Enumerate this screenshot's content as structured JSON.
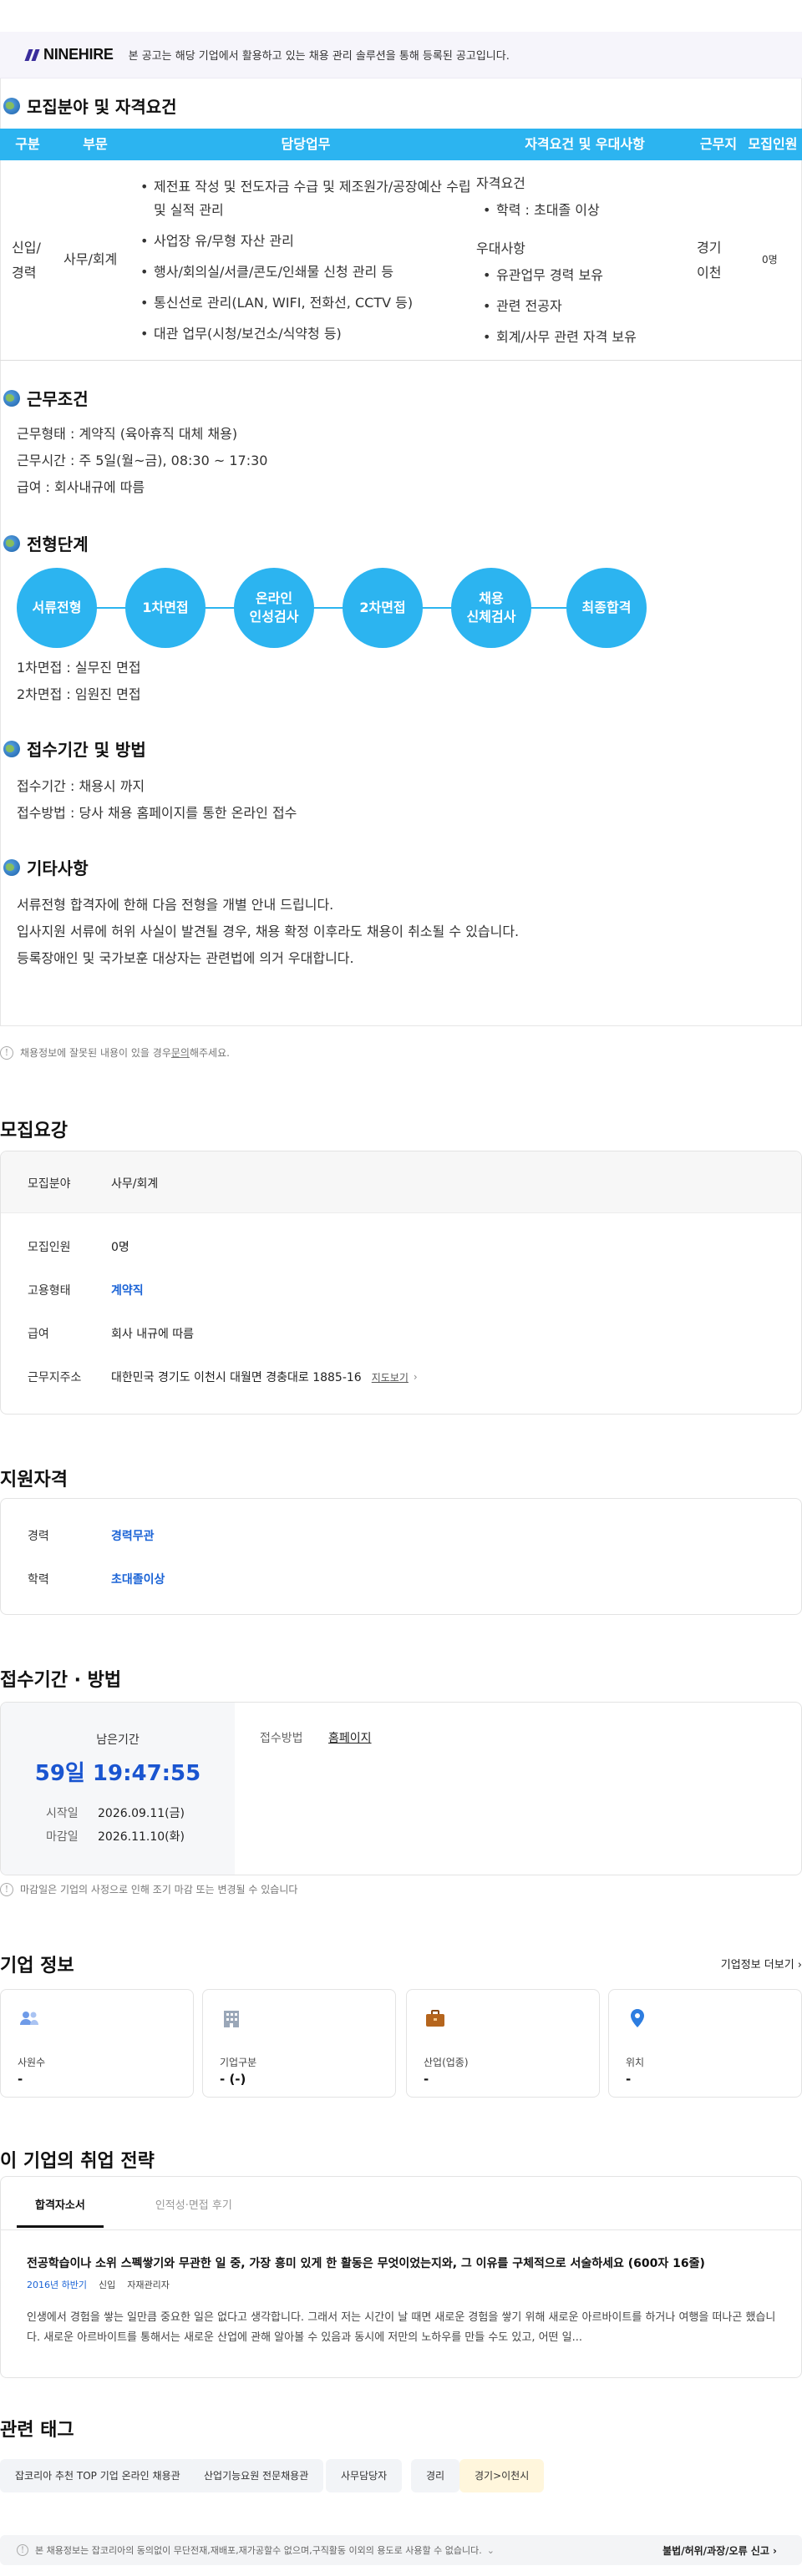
{
  "banner": {
    "logo": "NINEHIRE",
    "text": "본 공고는 해당 기업에서 활용하고 있는 채용 관리 솔루션을 통해 등록된 공고입니다."
  },
  "recruit_field": {
    "title": "모집분야 및 자격요건",
    "headers": [
      "구분",
      "부문",
      "담당업무",
      "자격요건 및 우대사항",
      "근무지",
      "모집인원"
    ],
    "category": "신입/\n경력",
    "department": "사무/회계",
    "duties": [
      "제전표 작성 및 전도자금 수급 및 제조원가/공장예산 수립 및 실적 관리",
      "사업장 유/무형 자산 관리",
      "행사/회의실/서클/콘도/인쇄물 신청 관리 등",
      "통신선로 관리(LAN, WIFI, 전화선, CCTV 등)",
      "대관 업무(시청/보건소/식약청 등)"
    ],
    "qual_label": "자격요건",
    "qual_items": [
      "학력 : 초대졸 이상"
    ],
    "pref_label": "우대사항",
    "pref_items": [
      "유관업무 경력 보유",
      "관련 전공자",
      "회계/사무 관련 자격 보유"
    ],
    "location": "경기\n이천",
    "headcount": "0명"
  },
  "work_conditions": {
    "title": "근무조건",
    "lines": [
      "근무형태 : 계약직 (육아휴직 대체 채용)",
      "근무시간 : 주 5일(월~금), 08:30 ~ 17:30",
      "급여 : 회사내규에 따름"
    ]
  },
  "process": {
    "title": "전형단계",
    "steps": [
      "서류전형",
      "1차면접",
      "온라인\n인성검사",
      "2차면접",
      "채용\n신체검사",
      "최종합격"
    ],
    "notes": [
      "1차면접 : 실무진 면접",
      "2차면접 : 임원진 면접"
    ]
  },
  "apply_period": {
    "title": "접수기간 및 방법",
    "lines": [
      "접수기간 : 채용시 까지",
      "접수방법 : 당사 채용 홈페이지를 통한 온라인 접수"
    ]
  },
  "etc": {
    "title": "기타사항",
    "lines": [
      "서류전형 합격자에 한해 다음 전형을 개별 안내 드립니다.",
      "입사지원 서류에 허위 사실이 발견될 경우, 채용 확정 이후라도 채용이 취소될 수 있습니다.",
      "등록장애인 및 국가보훈 대상자는 관련법에 의거 우대합니다."
    ]
  },
  "report_notice": {
    "text": "채용정보에 잘못된 내용이 있을 경우 ",
    "link": "문의",
    "tail": "해주세요."
  },
  "summary": {
    "title": "모집요강",
    "field_label": "모집분야",
    "field_value": "사무/회계",
    "headcount_label": "모집인원",
    "headcount_value": "0명",
    "type_label": "고용형태",
    "type_value": "계약직",
    "salary_label": "급여",
    "salary_value": "회사 내규에 따름",
    "address_label": "근무지주소",
    "address_value": "대한민국 경기도 이천시 대월면 경충대로 1885-16",
    "map_link": "지도보기"
  },
  "qualification": {
    "title": "지원자격",
    "career_label": "경력",
    "career_value": "경력무관",
    "edu_label": "학력",
    "edu_value": "초대졸이상"
  },
  "deadline": {
    "title": "접수기간 · 방법",
    "remain_label": "남은기간",
    "remain_value": "59일 19:47:55",
    "start_label": "시작일",
    "start_value": "2026.09.11(금)",
    "end_label": "마감일",
    "end_value": "2026.11.10(화)",
    "method_label": "접수방법",
    "method_value": "홈페이지",
    "notice": "마감일은 기업의 사정으로 인해 조기 마감 또는 변경될 수 있습니다"
  },
  "company": {
    "title": "기업 정보",
    "more_link": "기업정보 더보기",
    "cards": [
      {
        "label": "사원수",
        "value": "-",
        "icon": "people-icon"
      },
      {
        "label": "기업구분",
        "value": "- (-)",
        "icon": "building-icon"
      },
      {
        "label": "산업(업종)",
        "value": "-",
        "icon": "briefcase-icon"
      },
      {
        "label": "위치",
        "value": "-",
        "icon": "location-pin-icon"
      }
    ]
  },
  "strategy": {
    "title": "이 기업의 취업 전략",
    "tabs": [
      "합격자소서",
      "인적성·면접 후기"
    ],
    "question": "전공학습이나 소위 스펙쌓기와 무관한 일 중, 가장 흥미 있게 한 활동은 무엇이었는지와, 그 이유를 구체적으로 서술하세요 (600자 16줄)",
    "meta_period": "2016년 하반기",
    "meta_type": "신입",
    "meta_job": "자재관리자",
    "excerpt": "인생에서 경험을 쌓는 일만큼 중요한 일은 없다고 생각합니다. 그래서 저는 시간이 날 때면 새로운 경험을 쌓기 위해 새로운 아르바이트를 하거나 여행을 떠나곤 했습니다. 새로운 아르바이트를 통해서는 새로운 산업에 관해 알아볼 수 있음과 동시에 저만의 노하우를 만들 수도 있고, 어떤 일..."
  },
  "tags": {
    "title": "관련 태그",
    "items": [
      "잡코리아 추천 TOP 기업 온라인 채용관",
      "산업기능요원 전문채용관",
      "사무담당자",
      "경리",
      "경기>이천시"
    ]
  },
  "footer": {
    "text": "본 채용정보는 잡코리아의 동의없이 무단전재,재배포,재가공할수 없으며,구직활동 이외의 용도로 사용할 수 없습니다.",
    "report": "불법/허위/과장/오류 신고"
  },
  "colors": {
    "accent": "#2cb4f0",
    "link_blue": "#1a63d6"
  }
}
